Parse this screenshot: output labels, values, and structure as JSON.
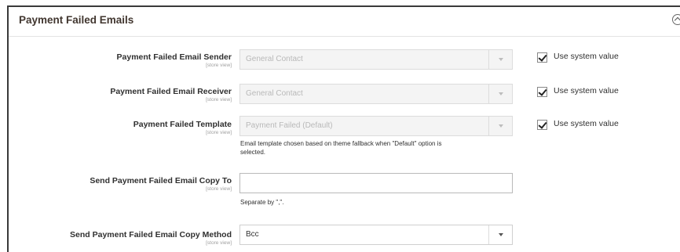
{
  "section": {
    "title": "Payment Failed Emails"
  },
  "fields": {
    "sender": {
      "label": "Payment Failed Email Sender",
      "scope": "[store view]",
      "value": "General Contact",
      "use_system_value": "Use system value"
    },
    "receiver": {
      "label": "Payment Failed Email Receiver",
      "scope": "[store view]",
      "value": "General Contact",
      "use_system_value": "Use system value"
    },
    "template": {
      "label": "Payment Failed Template",
      "scope": "[store view]",
      "value": "Payment Failed (Default)",
      "note_line1": "Email template chosen based on theme fallback when \"Default\" option is",
      "note_line2": "selected.",
      "use_system_value": "Use system value"
    },
    "copy_to": {
      "label": "Send Payment Failed Email Copy To",
      "scope": "[store view]",
      "value": "",
      "note": "Separate by \",\"."
    },
    "copy_method": {
      "label": "Send Payment Failed Email Copy Method",
      "scope": "[store view]",
      "value": "Bcc"
    }
  }
}
